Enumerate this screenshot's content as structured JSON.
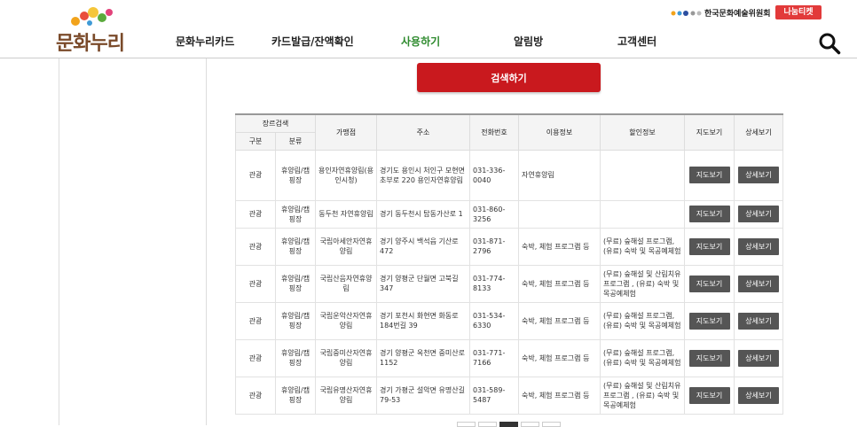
{
  "header": {
    "logo_text": "문화누리",
    "nav": [
      {
        "label": "문화누리카드"
      },
      {
        "label": "카드발급/잔액확인"
      },
      {
        "label": "사용하기"
      },
      {
        "label": "알림방"
      },
      {
        "label": "고객센터"
      }
    ],
    "partner": "한국문화예술위원회",
    "ticket": "나눔티켓"
  },
  "search_button": "검색하기",
  "table": {
    "headers": {
      "genre": "장르검색",
      "type": "구분",
      "category": "분류",
      "store": "가맹점",
      "address": "주소",
      "phone": "전화번호",
      "usage": "이용정보",
      "discount": "할인정보",
      "map": "지도보기",
      "detail": "상세보기"
    },
    "map_btn": "지도보기",
    "detail_btn": "상세보기",
    "rows": [
      {
        "type": "관광",
        "category": "휴양림/캠핑장",
        "store": "용인자연휴양림(용인시청)",
        "address": "경기도 용인시 처인구 모현면 초부로 220 용인자연휴양림",
        "phone": "031-336-0040",
        "usage": "자연휴양림",
        "discount": ""
      },
      {
        "type": "관광",
        "category": "휴양림/캠핑장",
        "store": "동두천 자연휴양림",
        "address": "경기 동두천시 탑동가산로 1",
        "phone": "031-860-3256",
        "usage": "",
        "discount": ""
      },
      {
        "type": "관광",
        "category": "휴양림/캠핑장",
        "store": "국립아세안자연휴양림",
        "address": "경기 양주시 백석읍 기산로 472",
        "phone": "031-871-2796",
        "usage": "숙박, 체험 프로그램 등",
        "discount": "(무료) 숲해설 프로그램, (유료) 숙박 및 목공예체험"
      },
      {
        "type": "관광",
        "category": "휴양림/캠핑장",
        "store": "국립산음자연휴양림",
        "address": "경기 양평군 단월면 고북길 347",
        "phone": "031-774-8133",
        "usage": "숙박, 체험 프로그램 등",
        "discount": "(무료) 숲해설 및 산림치유프로그램 , (유료) 숙박 및 목공예체험"
      },
      {
        "type": "관광",
        "category": "휴양림/캠핑장",
        "store": "국립운악산자연휴양림",
        "address": "경기 포천시 화현면 화동로 184번길 39",
        "phone": "031-534-6330",
        "usage": "숙박, 체험 프로그램 등",
        "discount": "(무료) 숲해설 프로그램, (유료) 숙박 및 목공예체험"
      },
      {
        "type": "관광",
        "category": "휴양림/캠핑장",
        "store": "국립중미산자연휴양림",
        "address": "경기 양평군 옥천면 중미산로 1152",
        "phone": "031-771-7166",
        "usage": "숙박, 체험 프로그램 등",
        "discount": "(무료) 숲해설 프로그램, (유료) 숙박 및 목공예체험"
      },
      {
        "type": "관광",
        "category": "휴양림/캠핑장",
        "store": "국립유명산자연휴양림",
        "address": "경기 가평군 설악면 유명산길 79-53",
        "phone": "031-589-5487",
        "usage": "숙박, 체험 프로그램 등",
        "discount": "(무료) 숲해설 및 산림치유프로그램 , (유료) 숙박 및 목공예체험"
      }
    ]
  }
}
